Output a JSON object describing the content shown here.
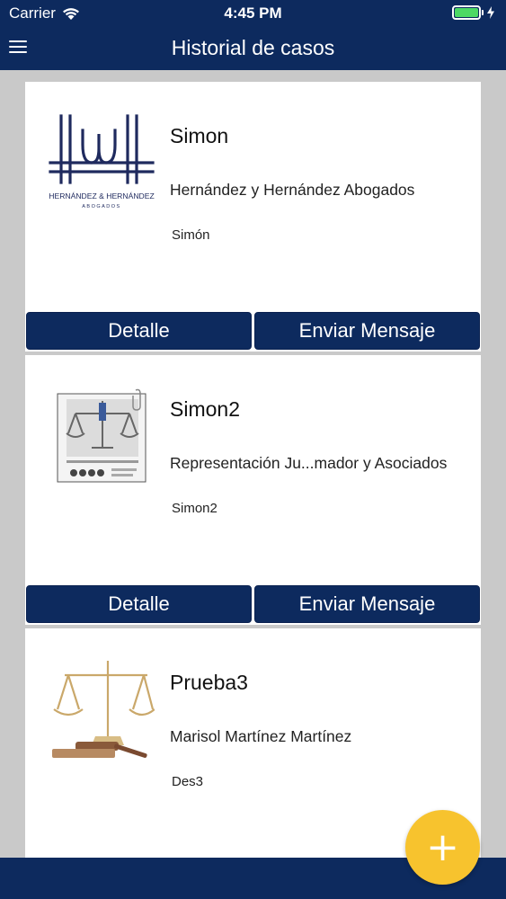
{
  "status_bar": {
    "carrier": "Carrier",
    "time": "4:45 PM"
  },
  "header": {
    "title": "Historial de casos"
  },
  "cases": [
    {
      "title": "Simon",
      "firm": "Hernández y Hernández Abogados",
      "description": "Simón",
      "logo_text": [
        "HERNÁNDEZ & HERNÁNDEZ",
        "ABOGADOS"
      ],
      "detail_label": "Detalle",
      "message_label": "Enviar Mensaje"
    },
    {
      "title": "Simon2",
      "firm": "Representación Ju...mador y Asociados",
      "description": "Simon2",
      "detail_label": "Detalle",
      "message_label": "Enviar Mensaje"
    },
    {
      "title": "Prueba3",
      "firm": "Marisol Martínez Martínez",
      "description": "Des3"
    }
  ],
  "fab": {
    "label": "+"
  },
  "colors": {
    "primary": "#0d2a5e",
    "accent": "#f7c32e",
    "background": "#c9c9c9",
    "battery": "#4cd964"
  }
}
